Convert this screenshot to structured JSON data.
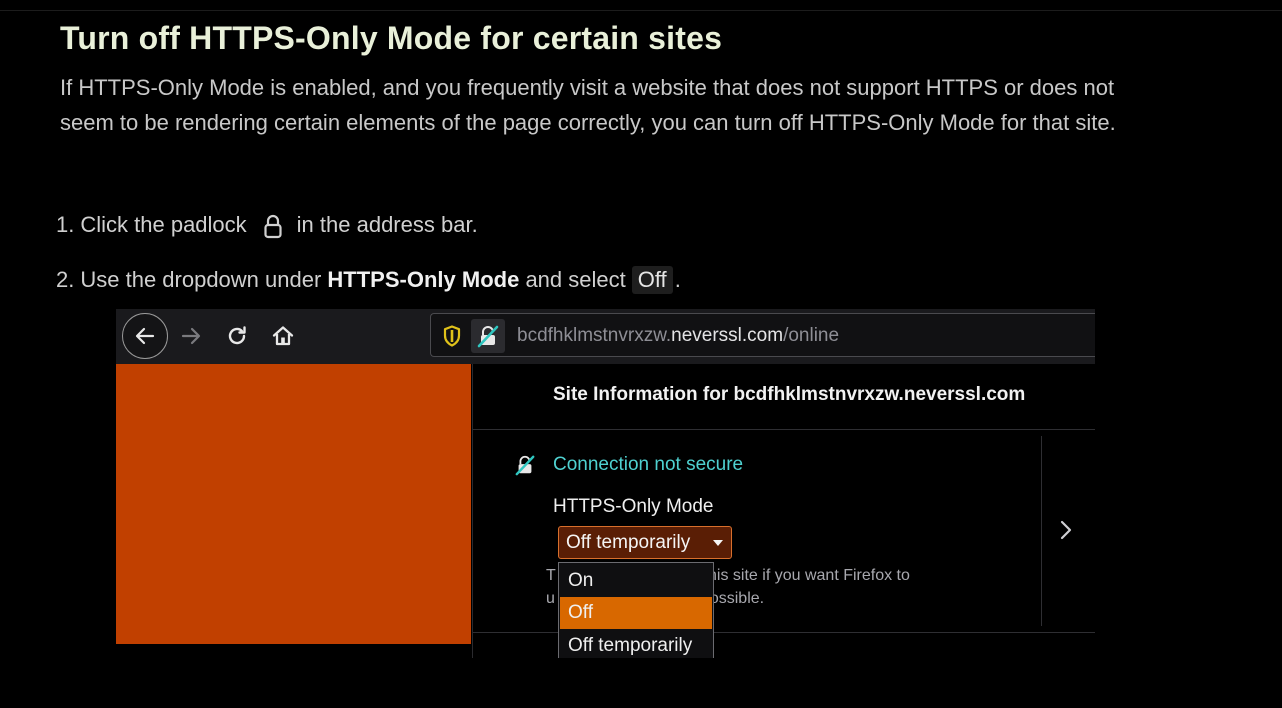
{
  "heading": "Turn off HTTPS-Only Mode for certain sites",
  "intro": "If HTTPS-Only Mode is enabled, and you frequently visit a website that does not support HTTPS or does not seem to be rendering certain elements of the page correctly, you can turn off HTTPS-Only Mode for that site.",
  "steps": [
    {
      "num": "1.",
      "before": "Click the padlock",
      "icon": "padlock-icon",
      "after": "in the address bar."
    },
    {
      "num": "2.",
      "before": "Use the dropdown under",
      "strong": "HTTPS-Only Mode",
      "middle": "and select",
      "code": "Off",
      "after": "."
    }
  ],
  "screenshot": {
    "url": {
      "prefix": "bcdfhklmstnvrxzw.",
      "host": "neverssl.com",
      "path": "/online"
    },
    "site_info_title": "Site Information for bcdfhklmstnvrxzw.neverssl.com",
    "connection_status": "Connection not secure",
    "https_only_label": "HTTPS-Only Mode",
    "select_value": "Off temporarily",
    "description_line1": "Mode for this site if you want Firefox to",
    "description_line2": "on when possible.",
    "description_prefix1": "T",
    "description_prefix2": "u",
    "options": [
      {
        "label": "On",
        "selected": false
      },
      {
        "label": "Off",
        "selected": true
      },
      {
        "label": "Off temporarily",
        "selected": false
      }
    ],
    "colors": {
      "page_content": "#c14000",
      "accent_orange": "#d86800",
      "insecure_teal": "#4fd1d0"
    }
  }
}
